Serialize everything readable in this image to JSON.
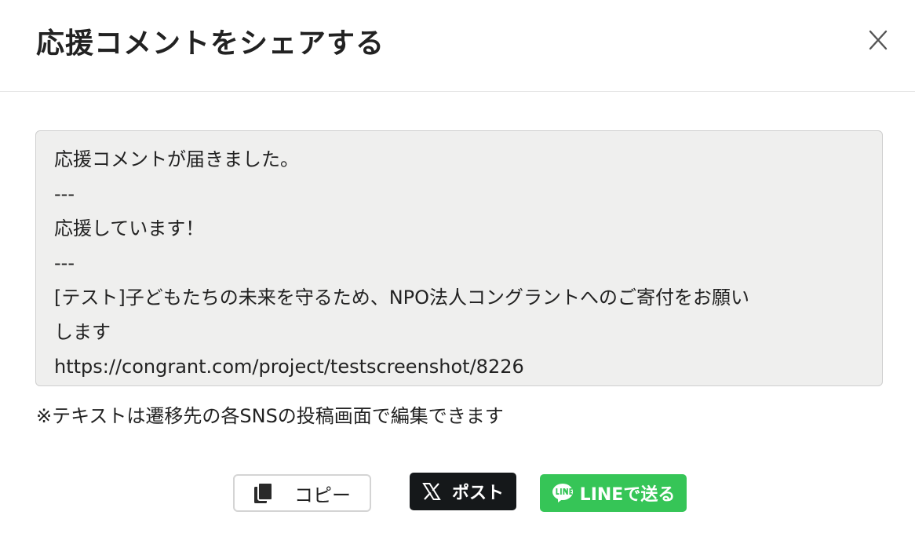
{
  "modal": {
    "title": "応援コメントをシェアする",
    "close_icon": "close-icon"
  },
  "share_text": {
    "lines": [
      "応援コメントが届きました。",
      "---",
      "応援しています！",
      "---",
      "[テスト]子どもたちの未来を守るため、NPO法人コングラントへのご寄付をお願い",
      "します",
      "https://congrant.com/project/testscreenshot/8226"
    ]
  },
  "note": "※テキストは遷移先の各SNSの投稿画面で編集できます",
  "buttons": {
    "copy": {
      "label": "コピー",
      "icon": "copy-icon"
    },
    "x_post": {
      "label": "ポスト",
      "icon": "x-logo-icon",
      "color": "#15181a"
    },
    "line": {
      "label": "LINEで送る",
      "icon": "line-logo-icon",
      "color": "#36c557"
    }
  }
}
